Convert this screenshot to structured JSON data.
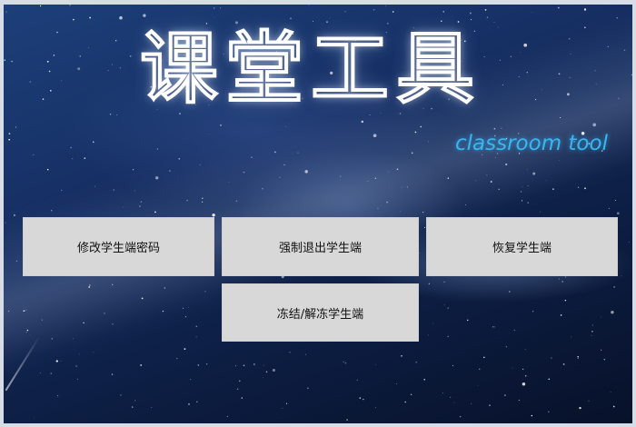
{
  "app": {
    "title": "课堂工具",
    "subtitle": "classroom tool"
  },
  "buttons": {
    "modify_password": "修改学生端密码",
    "force_exit": "强制退出学生端",
    "restore": "恢复学生端",
    "freeze_unfreeze": "冻结/解冻学生端"
  },
  "colors": {
    "subtitle": "#39b6f2",
    "button_bg": "#d8d8d8",
    "background": "#162f63"
  },
  "icons": []
}
